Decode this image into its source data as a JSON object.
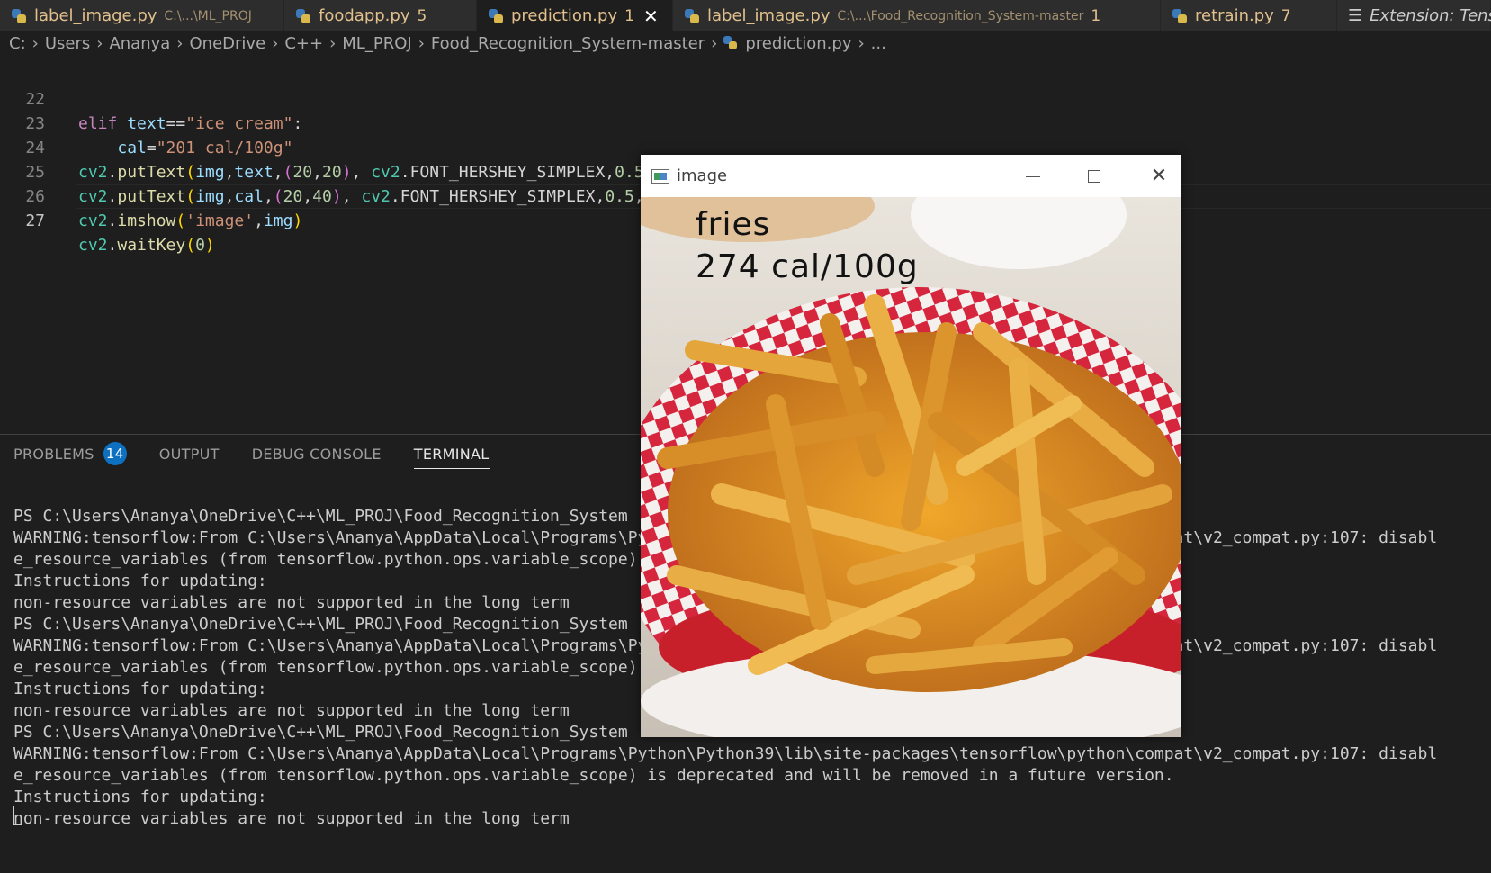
{
  "tabs": [
    {
      "label": "label_image.py",
      "desc": "C:\\...\\ML_PROJ",
      "count": "",
      "active": false
    },
    {
      "label": "foodapp.py",
      "desc": "",
      "count": "5",
      "active": false
    },
    {
      "label": "prediction.py",
      "desc": "",
      "count": "1",
      "active": true
    },
    {
      "label": "label_image.py",
      "desc": "C:\\...\\Food_Recognition_System-master",
      "count": "1",
      "active": false
    },
    {
      "label": "retrain.py",
      "desc": "",
      "count": "7",
      "active": false
    },
    {
      "label": "Extension: Tens",
      "desc": "",
      "count": "",
      "active": false
    }
  ],
  "breadcrumb": [
    "C:",
    "Users",
    "Ananya",
    "OneDrive",
    "C++",
    "ML_PROJ",
    "Food_Recognition_System-master",
    "prediction.py",
    "..."
  ],
  "editor": {
    "line_numbers": [
      "22",
      "23",
      "24",
      "25",
      "26",
      "27"
    ],
    "lines": [
      "elif text==\"ice cream\":",
      "    cal=\"201 cal/100g\"",
      "cv2.putText(img,text,(20,20), cv2.FONT_HERSHEY_SIMPLEX,0.5,(0,0,0),1,cv2.LINE_AA)",
      "cv2.putText(img,cal,(20,40), cv2.FONT_HERSHEY_SIMPLEX,0.5,(0,0,0),1,cv2.LINE_AA)",
      "cv2.imshow('image',img)",
      "cv2.waitKey(0)"
    ]
  },
  "panel": {
    "tabs": [
      "PROBLEMS",
      "OUTPUT",
      "DEBUG CONSOLE",
      "TERMINAL"
    ],
    "problems_count": "14",
    "active_tab": "TERMINAL",
    "terminal_lines": [
      "PS C:\\Users\\Ananya\\OneDrive\\C++\\ML_PROJ\\Food_Recognition_System",
      "WARNING:tensorflow:From C:\\Users\\Ananya\\AppData\\Local\\Programs\\Python\\Python39\\lib\\site-packages\\tensorflow\\python\\compat\\v2_compat.py:107: disabl",
      "e_resource_variables (from tensorflow.python.ops.variable_scope) is deprecated and will be removed in a future version.",
      "Instructions for updating:",
      "non-resource variables are not supported in the long term",
      "PS C:\\Users\\Ananya\\OneDrive\\C++\\ML_PROJ\\Food_Recognition_System",
      "WARNING:tensorflow:From C:\\Users\\Ananya\\AppData\\Local\\Programs\\Python\\Python39\\lib\\site-packages\\tensorflow\\python\\compat\\v2_compat.py:107: disabl",
      "e_resource_variables (from tensorflow.python.ops.variable_scope) is deprecated and will be removed in a future version.",
      "Instructions for updating:",
      "non-resource variables are not supported in the long term",
      "PS C:\\Users\\Ananya\\OneDrive\\C++\\ML_PROJ\\Food_Recognition_System",
      "WARNING:tensorflow:From C:\\Users\\Ananya\\AppData\\Local\\Programs\\Python\\Python39\\lib\\site-packages\\tensorflow\\python\\compat\\v2_compat.py:107: disabl",
      "e_resource_variables (from tensorflow.python.ops.variable_scope) is deprecated and will be removed in a future version.",
      "Instructions for updating:",
      "non-resource variables are not supported in the long term"
    ]
  },
  "image_window": {
    "title": "image",
    "overlay_food": "fries",
    "overlay_cal": "274 cal/100g"
  },
  "icons": {
    "tab_file": "python-file-icon",
    "extension_tab": "extension-icon",
    "window_app": "opencv-window-icon",
    "minimize": "minimize-icon",
    "maximize": "maximize-icon",
    "close": "close-icon"
  },
  "colors": {
    "editor_bg": "#1e1e1e",
    "tab_modified_text": "#e2c08d",
    "badge_bg": "#0e70c0",
    "keyword": "#c586c0",
    "string": "#ce9178"
  }
}
